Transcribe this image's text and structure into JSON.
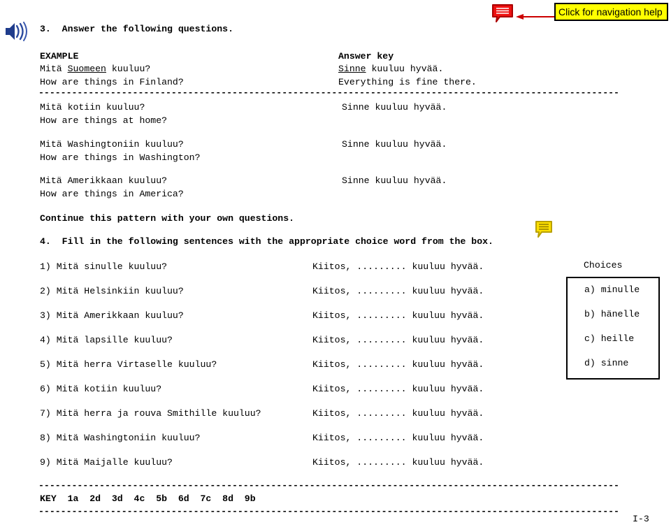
{
  "nav_help": {
    "label": "Click for navigation help",
    "bubble_icon": "speech-bubble-icon",
    "arrow_icon": "left-arrow-icon",
    "box_color": "#ffff00",
    "bubble_color": "#ee1111",
    "arrow_color": "#cc0000"
  },
  "audio": {
    "icon": "speaker-icon",
    "color": "#1f3c8c"
  },
  "section3": {
    "heading": "3.  Answer the following questions.",
    "example_label": "EXAMPLE",
    "answer_key_label": "Answer key",
    "example": {
      "fi_prefix": "Mitä ",
      "fi_underlined": "Suomeen",
      "fi_suffix": " kuuluu?",
      "en": "How are things in Finland?",
      "key_underlined": "Sinne",
      "key_suffix": " kuuluu hyvää.",
      "key_en": "Everything is fine there."
    },
    "items": [
      {
        "fi": "Mitä kotiin kuuluu?",
        "en": "How are things at home?",
        "answer": "Sinne kuuluu hyvää."
      },
      {
        "fi": "Mitä Washingtoniin kuuluu?",
        "en": "How are things in Washington?",
        "answer": "Sinne kuuluu hyvää."
      },
      {
        "fi": "Mitä Amerikkaan kuuluu?",
        "en": "How are things in America?",
        "answer": "Sinne kuuluu hyvää."
      }
    ],
    "continue_note": "Continue this pattern with your own questions."
  },
  "section4": {
    "heading": "4.  Fill in the following sentences with the appropriate choice word from the box.",
    "note_icon": "note-bubble-icon",
    "note_color": "#ffe000",
    "answer_template": "Kiitos, ......... kuuluu hyvää.",
    "questions": [
      "1) Mitä sinulle kuuluu?",
      "2) Mitä Helsinkiin kuuluu?",
      "3) Mitä Amerikkaan kuuluu?",
      "4) Mitä lapsille kuuluu?",
      "5) Mitä herra Virtaselle kuuluu?",
      "6) Mitä kotiin kuuluu?",
      "7) Mitä herra ja rouva Smithille kuuluu?",
      "8) Mitä Washingtoniin kuuluu?",
      "9) Mitä Maijalle kuuluu?"
    ],
    "choices_label": "Choices",
    "choices": [
      "a) minulle",
      "b) hänelle",
      "c) heille",
      "d) sinne"
    ]
  },
  "key": {
    "line": "KEY  1a  2d  3d  4c  5b  6d  7c  8d  9b"
  },
  "footer": {
    "page": "I-3"
  },
  "rules": {
    "top_dashes": "---------------------------------------------------------------------------------------------------------",
    "key_dashes": "---------------------------------------------------------------------------------------------------------"
  }
}
